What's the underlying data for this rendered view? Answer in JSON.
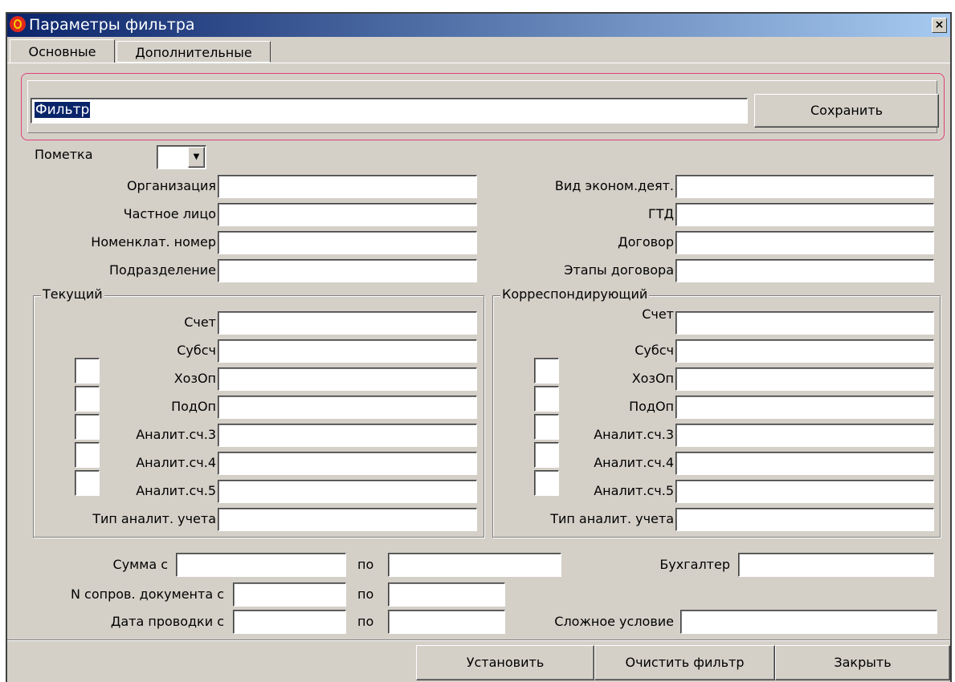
{
  "window": {
    "title": "Параметры фильтра",
    "close_glyph": "×"
  },
  "tabs": [
    {
      "label": "Основные",
      "active": true
    },
    {
      "label": "Дополнительные",
      "active": false
    }
  ],
  "filter": {
    "name_value": "Фильтр",
    "save_label": "Сохранить"
  },
  "mark": {
    "label": "Пометка",
    "value": ""
  },
  "left_fields": {
    "org": "Организация",
    "person": "Частное лицо",
    "nomenclature": "Номенклат. номер",
    "division": "Подразделение"
  },
  "right_fields": {
    "activity": "Вид эконом.деят.",
    "gtd": "ГТД",
    "contract": "Договор",
    "stages": "Этапы договора"
  },
  "current": {
    "title": "Текущий",
    "account": "Счет",
    "subaccount": "Субсч",
    "op": "ХозОп",
    "subop": "ПодОп",
    "an3": "Аналит.сч.3",
    "an4": "Аналит.сч.4",
    "an5": "Аналит.сч.5",
    "type": "Тип аналит. учета"
  },
  "corr": {
    "title": "Корреспондирующий",
    "account": "Счет",
    "subaccount": "Субсч",
    "op": "ХозОп",
    "subop": "ПодОп",
    "an3": "Аналит.сч.3",
    "an4": "Аналит.сч.4",
    "an5": "Аналит.сч.5",
    "type": "Тип аналит. учета"
  },
  "bottom": {
    "sum_from": "Сумма с",
    "to": "по",
    "accountant": "Бухгалтер",
    "doc_from": "N сопров. документа с",
    "date_from": "Дата проводки с",
    "complex": "Сложное условие"
  },
  "buttons": {
    "apply": "Установить",
    "clear": "Очистить фильтр",
    "close": "Закрыть"
  },
  "colors": {
    "title_start": "#0a246a",
    "title_end": "#a6caf0",
    "face": "#d4d0c8",
    "highlight_frame": "#e0407a",
    "selection": "#0a246a"
  }
}
